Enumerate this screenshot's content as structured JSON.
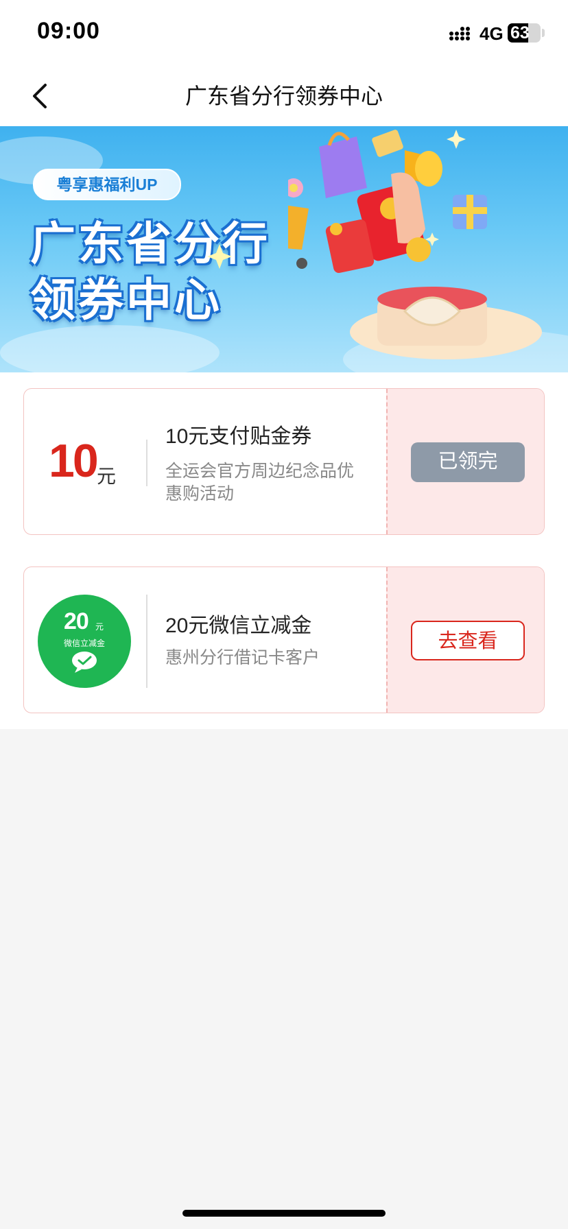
{
  "status_bar": {
    "time": "09:00",
    "network": "4G",
    "battery": "63",
    "battery_level": 0.63
  },
  "nav": {
    "title": "广东省分行领券中心"
  },
  "banner": {
    "tag": "粤享惠福利UP",
    "title_line1": "广东省分行",
    "title_line2": "领券中心"
  },
  "coupons": [
    {
      "amount": "10",
      "unit": "元",
      "title": "10元支付贴金券",
      "description": "全运会官方周边纪念品优惠购活动",
      "button": "已领完",
      "state": "claimed"
    },
    {
      "badge_amount": "20",
      "badge_unit": "元",
      "badge_text": "微信立减金",
      "title": "20元微信立减金",
      "description": "惠州分行借记卡客户",
      "button": "去查看",
      "state": "available"
    }
  ],
  "colors": {
    "accent_red": "#d9261c",
    "wechat_green": "#1fb653",
    "disabled_gray": "#8e9aa8"
  }
}
